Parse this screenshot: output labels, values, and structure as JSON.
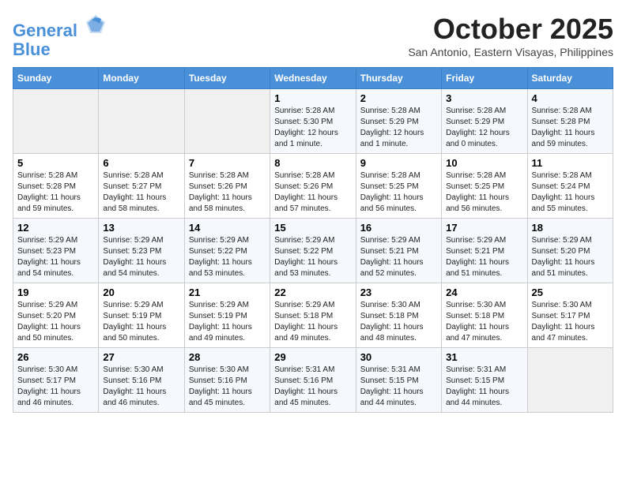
{
  "header": {
    "logo_line1": "General",
    "logo_line2": "Blue",
    "month": "October 2025",
    "location": "San Antonio, Eastern Visayas, Philippines"
  },
  "weekdays": [
    "Sunday",
    "Monday",
    "Tuesday",
    "Wednesday",
    "Thursday",
    "Friday",
    "Saturday"
  ],
  "weeks": [
    [
      {
        "day": "",
        "sunrise": "",
        "sunset": "",
        "daylight": ""
      },
      {
        "day": "",
        "sunrise": "",
        "sunset": "",
        "daylight": ""
      },
      {
        "day": "",
        "sunrise": "",
        "sunset": "",
        "daylight": ""
      },
      {
        "day": "1",
        "sunrise": "Sunrise: 5:28 AM",
        "sunset": "Sunset: 5:30 PM",
        "daylight": "Daylight: 12 hours and 1 minute."
      },
      {
        "day": "2",
        "sunrise": "Sunrise: 5:28 AM",
        "sunset": "Sunset: 5:29 PM",
        "daylight": "Daylight: 12 hours and 1 minute."
      },
      {
        "day": "3",
        "sunrise": "Sunrise: 5:28 AM",
        "sunset": "Sunset: 5:29 PM",
        "daylight": "Daylight: 12 hours and 0 minutes."
      },
      {
        "day": "4",
        "sunrise": "Sunrise: 5:28 AM",
        "sunset": "Sunset: 5:28 PM",
        "daylight": "Daylight: 11 hours and 59 minutes."
      }
    ],
    [
      {
        "day": "5",
        "sunrise": "Sunrise: 5:28 AM",
        "sunset": "Sunset: 5:28 PM",
        "daylight": "Daylight: 11 hours and 59 minutes."
      },
      {
        "day": "6",
        "sunrise": "Sunrise: 5:28 AM",
        "sunset": "Sunset: 5:27 PM",
        "daylight": "Daylight: 11 hours and 58 minutes."
      },
      {
        "day": "7",
        "sunrise": "Sunrise: 5:28 AM",
        "sunset": "Sunset: 5:26 PM",
        "daylight": "Daylight: 11 hours and 58 minutes."
      },
      {
        "day": "8",
        "sunrise": "Sunrise: 5:28 AM",
        "sunset": "Sunset: 5:26 PM",
        "daylight": "Daylight: 11 hours and 57 minutes."
      },
      {
        "day": "9",
        "sunrise": "Sunrise: 5:28 AM",
        "sunset": "Sunset: 5:25 PM",
        "daylight": "Daylight: 11 hours and 56 minutes."
      },
      {
        "day": "10",
        "sunrise": "Sunrise: 5:28 AM",
        "sunset": "Sunset: 5:25 PM",
        "daylight": "Daylight: 11 hours and 56 minutes."
      },
      {
        "day": "11",
        "sunrise": "Sunrise: 5:28 AM",
        "sunset": "Sunset: 5:24 PM",
        "daylight": "Daylight: 11 hours and 55 minutes."
      }
    ],
    [
      {
        "day": "12",
        "sunrise": "Sunrise: 5:29 AM",
        "sunset": "Sunset: 5:23 PM",
        "daylight": "Daylight: 11 hours and 54 minutes."
      },
      {
        "day": "13",
        "sunrise": "Sunrise: 5:29 AM",
        "sunset": "Sunset: 5:23 PM",
        "daylight": "Daylight: 11 hours and 54 minutes."
      },
      {
        "day": "14",
        "sunrise": "Sunrise: 5:29 AM",
        "sunset": "Sunset: 5:22 PM",
        "daylight": "Daylight: 11 hours and 53 minutes."
      },
      {
        "day": "15",
        "sunrise": "Sunrise: 5:29 AM",
        "sunset": "Sunset: 5:22 PM",
        "daylight": "Daylight: 11 hours and 53 minutes."
      },
      {
        "day": "16",
        "sunrise": "Sunrise: 5:29 AM",
        "sunset": "Sunset: 5:21 PM",
        "daylight": "Daylight: 11 hours and 52 minutes."
      },
      {
        "day": "17",
        "sunrise": "Sunrise: 5:29 AM",
        "sunset": "Sunset: 5:21 PM",
        "daylight": "Daylight: 11 hours and 51 minutes."
      },
      {
        "day": "18",
        "sunrise": "Sunrise: 5:29 AM",
        "sunset": "Sunset: 5:20 PM",
        "daylight": "Daylight: 11 hours and 51 minutes."
      }
    ],
    [
      {
        "day": "19",
        "sunrise": "Sunrise: 5:29 AM",
        "sunset": "Sunset: 5:20 PM",
        "daylight": "Daylight: 11 hours and 50 minutes."
      },
      {
        "day": "20",
        "sunrise": "Sunrise: 5:29 AM",
        "sunset": "Sunset: 5:19 PM",
        "daylight": "Daylight: 11 hours and 50 minutes."
      },
      {
        "day": "21",
        "sunrise": "Sunrise: 5:29 AM",
        "sunset": "Sunset: 5:19 PM",
        "daylight": "Daylight: 11 hours and 49 minutes."
      },
      {
        "day": "22",
        "sunrise": "Sunrise: 5:29 AM",
        "sunset": "Sunset: 5:18 PM",
        "daylight": "Daylight: 11 hours and 49 minutes."
      },
      {
        "day": "23",
        "sunrise": "Sunrise: 5:30 AM",
        "sunset": "Sunset: 5:18 PM",
        "daylight": "Daylight: 11 hours and 48 minutes."
      },
      {
        "day": "24",
        "sunrise": "Sunrise: 5:30 AM",
        "sunset": "Sunset: 5:18 PM",
        "daylight": "Daylight: 11 hours and 47 minutes."
      },
      {
        "day": "25",
        "sunrise": "Sunrise: 5:30 AM",
        "sunset": "Sunset: 5:17 PM",
        "daylight": "Daylight: 11 hours and 47 minutes."
      }
    ],
    [
      {
        "day": "26",
        "sunrise": "Sunrise: 5:30 AM",
        "sunset": "Sunset: 5:17 PM",
        "daylight": "Daylight: 11 hours and 46 minutes."
      },
      {
        "day": "27",
        "sunrise": "Sunrise: 5:30 AM",
        "sunset": "Sunset: 5:16 PM",
        "daylight": "Daylight: 11 hours and 46 minutes."
      },
      {
        "day": "28",
        "sunrise": "Sunrise: 5:30 AM",
        "sunset": "Sunset: 5:16 PM",
        "daylight": "Daylight: 11 hours and 45 minutes."
      },
      {
        "day": "29",
        "sunrise": "Sunrise: 5:31 AM",
        "sunset": "Sunset: 5:16 PM",
        "daylight": "Daylight: 11 hours and 45 minutes."
      },
      {
        "day": "30",
        "sunrise": "Sunrise: 5:31 AM",
        "sunset": "Sunset: 5:15 PM",
        "daylight": "Daylight: 11 hours and 44 minutes."
      },
      {
        "day": "31",
        "sunrise": "Sunrise: 5:31 AM",
        "sunset": "Sunset: 5:15 PM",
        "daylight": "Daylight: 11 hours and 44 minutes."
      },
      {
        "day": "",
        "sunrise": "",
        "sunset": "",
        "daylight": ""
      }
    ]
  ]
}
